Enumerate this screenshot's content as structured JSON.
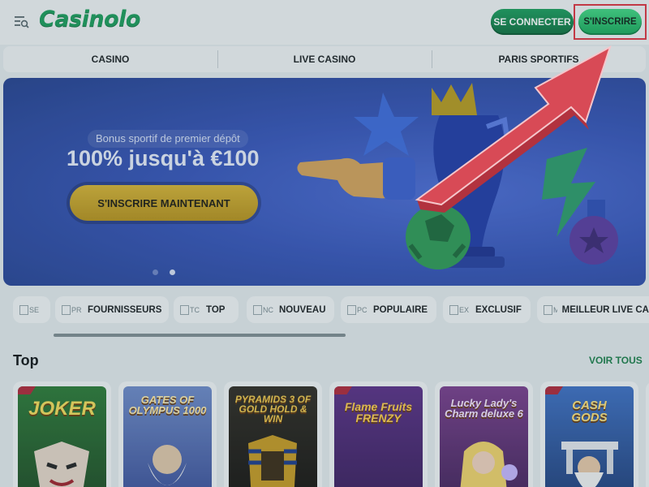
{
  "header": {
    "logo": "Casinolo",
    "login_label": "SE CONNECTER",
    "register_label": "S'INSCRIRE"
  },
  "nav": {
    "items": [
      "CASINO",
      "LIVE CASINO",
      "PARIS SPORTIFS"
    ]
  },
  "banner": {
    "subtitle": "Bonus sportif de premier dépôt",
    "title": "100% jusqu'à €100",
    "cta_label": "S'INSCRIRE MAINTENANT",
    "slides": 2,
    "active_slide": 2
  },
  "categories": [
    {
      "alt": "SE",
      "label": ""
    },
    {
      "alt": "PR",
      "label": "FOURNISSEURS"
    },
    {
      "alt": "TC",
      "label": "TOP"
    },
    {
      "alt": "NC",
      "label": "NOUVEAU"
    },
    {
      "alt": "PC",
      "label": "POPULAIRE"
    },
    {
      "alt": "EX",
      "label": "EXCLUSIF"
    },
    {
      "alt": "MI",
      "label": "MEILLEUR LIVE CA"
    }
  ],
  "top": {
    "title": "Top",
    "see_all_label": "VOIR TOUS",
    "games": [
      {
        "name": "JOKER",
        "exclusive": true
      },
      {
        "name": "GATES OF OLYMPUS 1000",
        "exclusive": false
      },
      {
        "name": "PYRAMIDS 3 OF GOLD HOLD & WIN",
        "exclusive": false
      },
      {
        "name": "Flame Fruits FRENZY",
        "exclusive": true
      },
      {
        "name": "Lucky Lady's Charm deluxe 6",
        "exclusive": false
      },
      {
        "name": "CASH GODS",
        "exclusive": true
      }
    ]
  },
  "colors": {
    "brand_green": "#1a9d5a",
    "register_green": "#2cc36f",
    "annotation_red": "#e03340",
    "banner_blue": "#3553b9",
    "cta_gold": "#c9a428"
  }
}
